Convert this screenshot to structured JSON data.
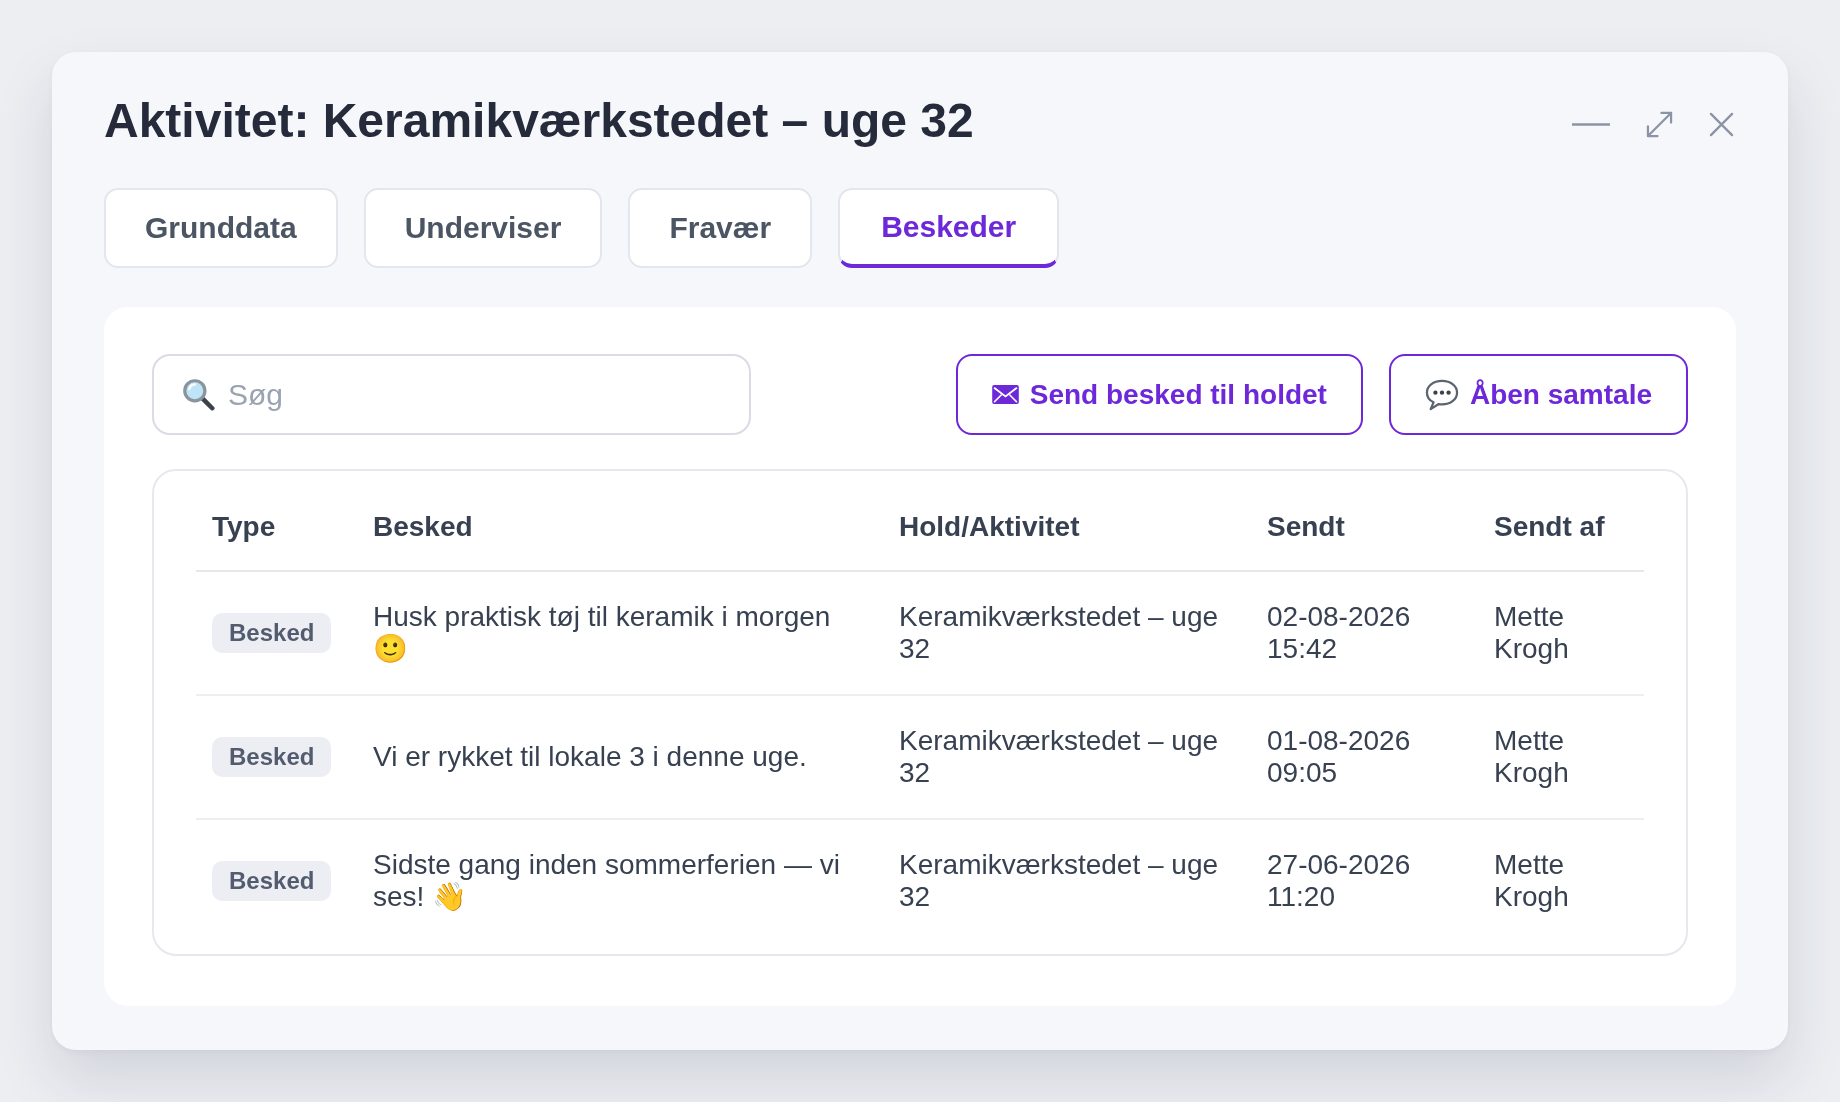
{
  "window": {
    "title": "Aktivitet: Keramikværkstedet – uge 32"
  },
  "tabs": [
    {
      "label": "Grunddata",
      "selected": false
    },
    {
      "label": "Underviser",
      "selected": false
    },
    {
      "label": "Fravær",
      "selected": false
    },
    {
      "label": "Beskeder",
      "selected": true
    }
  ],
  "search": {
    "placeholder": "Søg"
  },
  "actions": [
    {
      "kind": "mail",
      "label": "Send besked til holdet"
    },
    {
      "kind": "chat",
      "label": "Åben samtale"
    }
  ],
  "table": {
    "columns": [
      "Type",
      "Besked",
      "Hold/Aktivitet",
      "Sendt",
      "Sendt af"
    ],
    "rows": [
      {
        "type": "Besked",
        "message": "Husk praktisk tøj til keramik i morgen 🙂",
        "activity": "Keramikværkstedet – uge 32",
        "sent": "02-08-2026 15:42",
        "sender": "Mette Krogh"
      },
      {
        "type": "Besked",
        "message": "Vi er rykket til lokale 3 i denne uge.",
        "activity": "Keramikværkstedet – uge 32",
        "sent": "01-08-2026 09:05",
        "sender": "Mette Krogh"
      },
      {
        "type": "Besked",
        "message": "Sidste gang inden sommerferien — vi ses! 👋",
        "activity": "Keramikværkstedet – uge 32",
        "sent": "27-06-2026 11:20",
        "sender": "Mette Krogh"
      }
    ]
  }
}
